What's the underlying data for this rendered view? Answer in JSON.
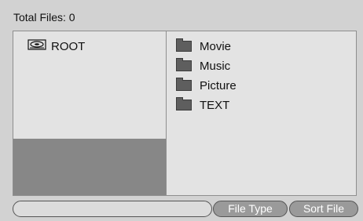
{
  "header": {
    "total_files": "Total Files: 0"
  },
  "tree": {
    "root_label": "ROOT",
    "root_icon": "hard-drive-icon"
  },
  "folders": [
    {
      "label": "Movie",
      "icon": "folder-icon"
    },
    {
      "label": "Music",
      "icon": "folder-icon"
    },
    {
      "label": "Picture",
      "icon": "folder-icon"
    },
    {
      "label": "TEXT",
      "icon": "folder-icon"
    }
  ],
  "bottom": {
    "path_value": "",
    "file_type_label": "File Type",
    "sort_file_label": "Sort File"
  },
  "colors": {
    "background": "#d2d2d2",
    "pane": "#e3e3e3",
    "pane_dark": "#878787",
    "folder": "#5e5e5e",
    "button": "#9a9a9a"
  }
}
